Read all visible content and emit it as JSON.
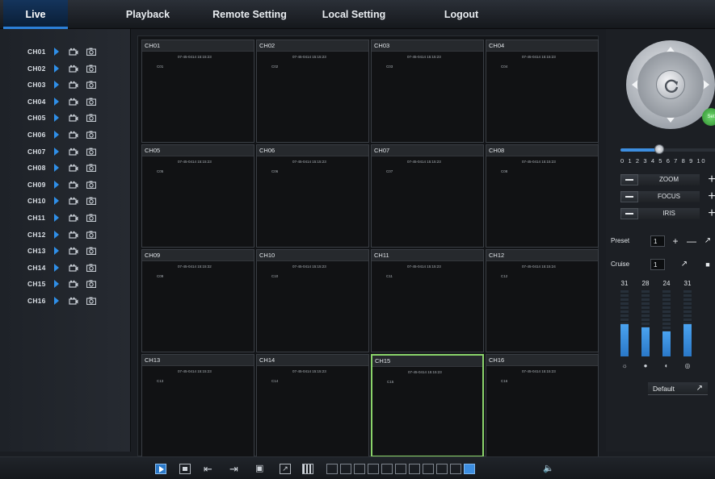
{
  "nav": {
    "tabs": [
      {
        "label": "Live"
      },
      {
        "label": "Playback"
      },
      {
        "label": "Remote Setting"
      },
      {
        "label": "Local Setting"
      },
      {
        "label": "Logout"
      }
    ]
  },
  "sidebar": {
    "channels": [
      {
        "label": "CH01"
      },
      {
        "label": "CH02"
      },
      {
        "label": "CH03"
      },
      {
        "label": "CH04"
      },
      {
        "label": "CH05"
      },
      {
        "label": "CH06"
      },
      {
        "label": "CH07"
      },
      {
        "label": "CH08"
      },
      {
        "label": "CH09"
      },
      {
        "label": "CH10"
      },
      {
        "label": "CH11"
      },
      {
        "label": "CH12"
      },
      {
        "label": "CH13"
      },
      {
        "label": "CH14"
      },
      {
        "label": "CH15"
      },
      {
        "label": "CH16"
      }
    ],
    "icons": {
      "play": "play-icon",
      "record": "record-icon",
      "snapshot": "snapshot-icon"
    }
  },
  "grid": {
    "tiles": [
      {
        "name": "CH01",
        "time": "07-45-0414 15:15:23",
        "osd": "C01"
      },
      {
        "name": "CH02",
        "time": "07-45-0414 15:15:23",
        "osd": "C02"
      },
      {
        "name": "CH03",
        "time": "07-45-0414 15:15:23",
        "osd": "C03"
      },
      {
        "name": "CH04",
        "time": "07-45-0414 15:15:23",
        "osd": "C04"
      },
      {
        "name": "CH05",
        "time": "07-45-0414 15:15:23",
        "osd": "C05"
      },
      {
        "name": "CH06",
        "time": "07-45-0414 15:15:23",
        "osd": "C06"
      },
      {
        "name": "CH07",
        "time": "07-45-0414 15:15:23",
        "osd": "C07"
      },
      {
        "name": "CH08",
        "time": "07-45-0414 15:15:23",
        "osd": "C08"
      },
      {
        "name": "CH09",
        "time": "07-45-0414 15:15:32",
        "osd": "C09"
      },
      {
        "name": "CH10",
        "time": "07-45-0414 15:15:23",
        "osd": "C10"
      },
      {
        "name": "CH11",
        "time": "07-45-0414 15:15:23",
        "osd": "C11"
      },
      {
        "name": "CH12",
        "time": "07-45-0414 15:15:24",
        "osd": "C12"
      },
      {
        "name": "CH13",
        "time": "07-45-0414 15:15:23",
        "osd": "C13"
      },
      {
        "name": "CH14",
        "time": "07-45-0414 15:15:23",
        "osd": "C14"
      },
      {
        "name": "CH15",
        "time": "07-45-0414 15:15:23",
        "osd": "C15"
      },
      {
        "name": "CH16",
        "time": "07-45-0414 15:15:23",
        "osd": "C16"
      }
    ],
    "selected_index": 14,
    "selected_color": "#8ad36a"
  },
  "ptz": {
    "set_label": "Set",
    "speed_labels": "0 1 2 3 4 5 6 7 8 9 10",
    "speed_value": 4,
    "speed_max": 10,
    "controls": [
      {
        "label": "ZOOM"
      },
      {
        "label": "FOCUS"
      },
      {
        "label": "IRIS"
      }
    ],
    "preset_label": "Preset",
    "preset_value": "1",
    "cruise_label": "Cruise",
    "cruise_value": "1"
  },
  "color": {
    "values": [
      {
        "value": "31",
        "level": 31
      },
      {
        "value": "28",
        "level": 28
      },
      {
        "value": "24",
        "level": 24
      },
      {
        "value": "31",
        "level": 31
      }
    ],
    "max": 63,
    "icons": [
      "brightness-icon",
      "contrast-icon",
      "saturation-icon",
      "hue-icon"
    ],
    "default_label": "Default"
  },
  "bottombar": {
    "icons": [
      "play-all-icon",
      "stop-all-icon",
      "prev-page-icon",
      "next-page-icon",
      "snapshot-all-icon",
      "fullscreen-icon",
      "stream-icon"
    ],
    "layouts": [
      "layout-1",
      "layout-4",
      "layout-6",
      "layout-8",
      "layout-9",
      "layout-10",
      "layout-13",
      "layout-16-a",
      "layout-16-b",
      "layout-16-c",
      "layout-16"
    ],
    "active_layout": 10,
    "volume_icon": "volume-icon",
    "accent": "#3d8ee0"
  }
}
